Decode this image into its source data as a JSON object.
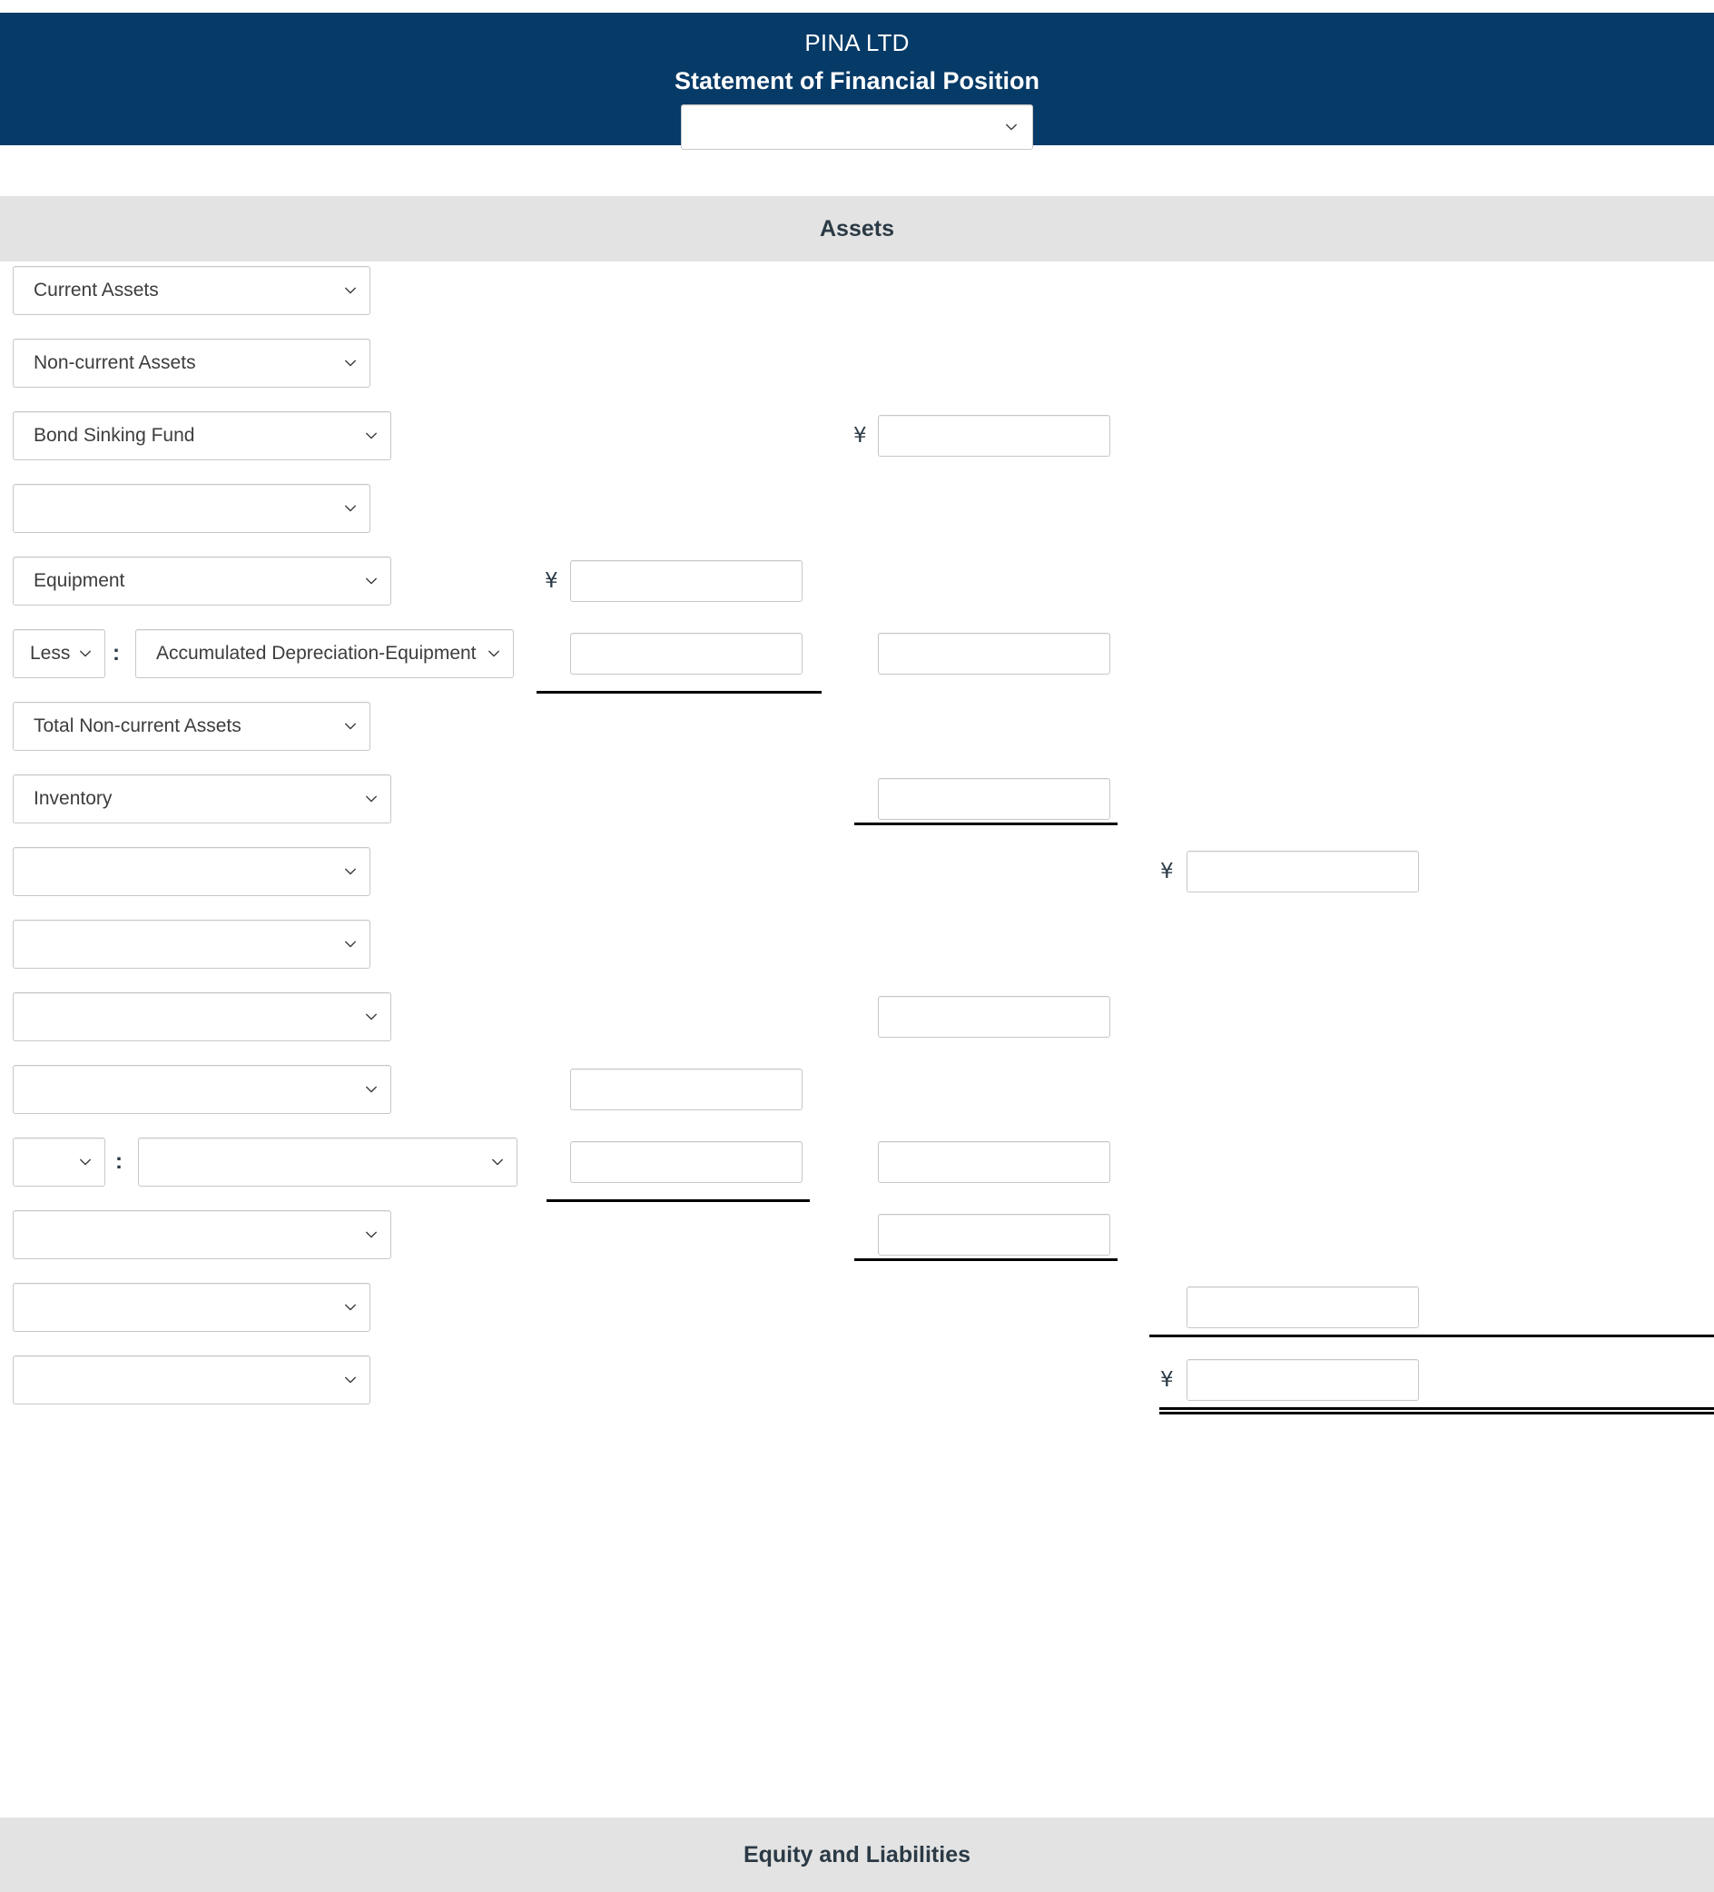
{
  "header": {
    "company": "PINA LTD",
    "title": "Statement of Financial Position",
    "date_select_value": "",
    "bg_color": "#063a67"
  },
  "sections": {
    "assets": "Assets",
    "equity_and_liabilities": "Equity and Liabilities"
  },
  "currency_symbol": "¥",
  "separator": ":",
  "rows": [
    {
      "label": "Current Assets",
      "col1": "",
      "col2": "",
      "col3": ""
    },
    {
      "label": "Non-current Assets",
      "col1": "",
      "col2": "",
      "col3": ""
    },
    {
      "label": "Bond Sinking Fund",
      "col1": "",
      "col2": "",
      "col3": ""
    },
    {
      "label": "",
      "col1": "",
      "col2": "",
      "col3": ""
    },
    {
      "label": "Equipment",
      "col1": "",
      "col2": "",
      "col3": ""
    },
    {
      "prefix": "Less",
      "label": "Accumulated Depreciation-Equipment",
      "col1": "",
      "col2": "",
      "col3": ""
    },
    {
      "label": "Total Non-current Assets",
      "col1": "",
      "col2": "",
      "col3": ""
    },
    {
      "label": "Inventory",
      "col1": "",
      "col2": "",
      "col3": ""
    },
    {
      "label": "",
      "col1": "",
      "col2": "",
      "col3": ""
    },
    {
      "label": "",
      "col1": "",
      "col2": "",
      "col3": ""
    },
    {
      "label": "",
      "col1": "",
      "col2": "",
      "col3": ""
    },
    {
      "label": "",
      "col1": "",
      "col2": "",
      "col3": ""
    },
    {
      "prefix": "",
      "label": "",
      "col1": "",
      "col2": "",
      "col3": ""
    },
    {
      "label": "",
      "col1": "",
      "col2": "",
      "col3": ""
    },
    {
      "label": "",
      "col1": "",
      "col2": "",
      "col3": ""
    },
    {
      "label": "",
      "col1": "",
      "col2": "",
      "col3": ""
    }
  ],
  "icons": {
    "chevron_down": "chevron-down-icon"
  }
}
